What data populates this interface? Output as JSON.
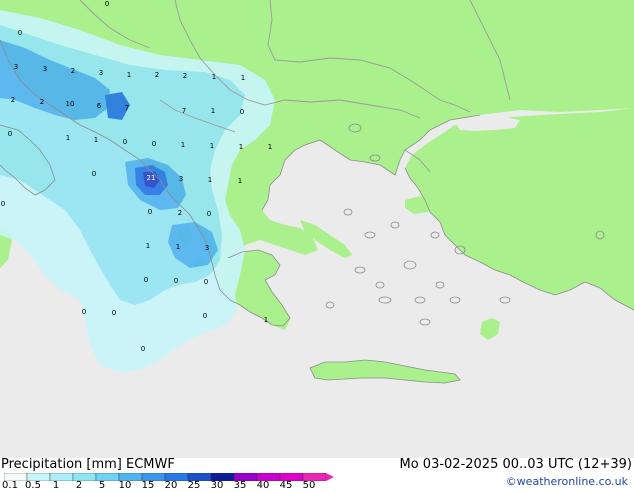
{
  "map": {
    "colors": {
      "sea": "#ebebeb",
      "land": "#aaf08c",
      "coast": "#8c8c8c",
      "border": "#9b9b9b",
      "precip_light": "#c8f5fa",
      "precip_mid": "#96e6f5",
      "precip_high": "#50b4f0",
      "precip_heavy": "#2878e6",
      "precip_core": "#2846c8"
    },
    "point_values": [
      {
        "label": "0"
      },
      {
        "label": "0"
      },
      {
        "label": "3"
      },
      {
        "label": "3"
      },
      {
        "label": "2"
      },
      {
        "label": "3"
      },
      {
        "label": "1"
      },
      {
        "label": "2"
      },
      {
        "label": "2"
      },
      {
        "label": "1"
      },
      {
        "label": "1"
      },
      {
        "label": "2"
      },
      {
        "label": "2"
      },
      {
        "label": "10"
      },
      {
        "label": "6"
      },
      {
        "label": "7"
      },
      {
        "label": "7"
      },
      {
        "label": "1"
      },
      {
        "label": "0"
      },
      {
        "label": "0"
      },
      {
        "label": "1"
      },
      {
        "label": "1"
      },
      {
        "label": "0"
      },
      {
        "label": "0"
      },
      {
        "label": "1"
      },
      {
        "label": "1"
      },
      {
        "label": "1"
      },
      {
        "label": "1"
      },
      {
        "label": "0"
      },
      {
        "label": "21"
      },
      {
        "label": "3"
      },
      {
        "label": "1"
      },
      {
        "label": "1"
      },
      {
        "label": "0"
      },
      {
        "label": "0"
      },
      {
        "label": "2"
      },
      {
        "label": "0"
      },
      {
        "label": "1"
      },
      {
        "label": "1"
      },
      {
        "label": "3"
      },
      {
        "label": "0"
      },
      {
        "label": "0"
      },
      {
        "label": "0"
      },
      {
        "label": "0"
      },
      {
        "label": "0"
      },
      {
        "label": "0"
      },
      {
        "label": "0"
      },
      {
        "label": "1"
      }
    ]
  },
  "footer": {
    "title": "Precipitation [mm]  ECMWF",
    "valid_time": "Mo 03-02-2025 00..03 UTC (12+39)",
    "credit": "©weatheronline.co.uk"
  },
  "colorbar": {
    "ticks": [
      "0.1",
      "0.5",
      "1",
      "2",
      "5",
      "10",
      "15",
      "20",
      "25",
      "30",
      "35",
      "40",
      "45",
      "50"
    ],
    "colors": [
      "#f5fafa",
      "#c8f5fa",
      "#aaeefa",
      "#8ce6f5",
      "#6ed2f5",
      "#50b4f0",
      "#3c96eb",
      "#2878e6",
      "#1e50c8",
      "#0a1e96",
      "#9600c8",
      "#c800d2",
      "#dc00c8",
      "#e628b4"
    ]
  }
}
